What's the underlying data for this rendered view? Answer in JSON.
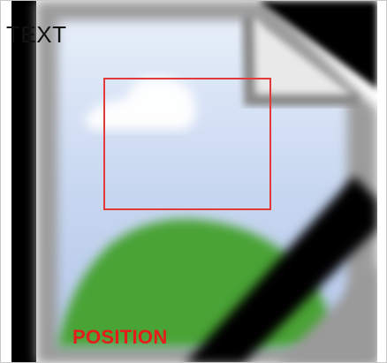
{
  "overlay": {
    "text_label": "TEXT",
    "position_label": "POSITION"
  },
  "icon": {
    "name": "broken-image-icon"
  },
  "colors": {
    "selection_border": "#e23a3a",
    "position_label": "#e51c1c"
  }
}
